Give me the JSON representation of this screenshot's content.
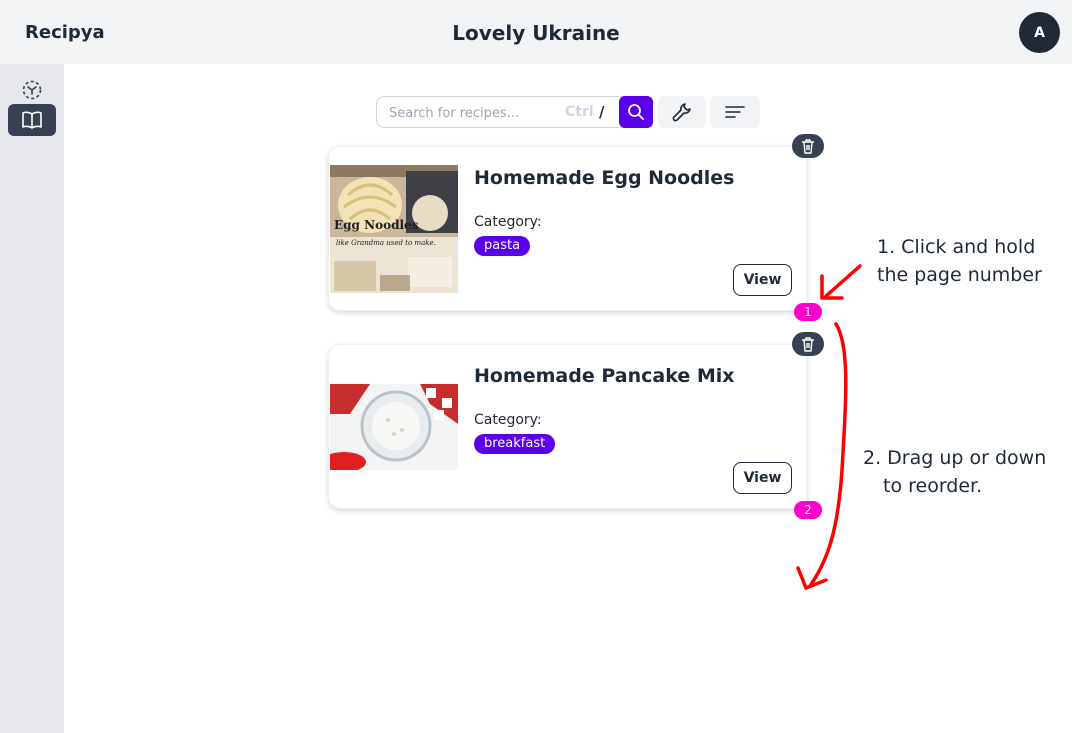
{
  "app": {
    "brand": "Recipya",
    "cookbook_title": "Lovely Ukraine",
    "avatar_initial": "A"
  },
  "sidebar": {
    "items": [
      {
        "icon": "scan-icon",
        "active": false
      },
      {
        "icon": "book-open-icon",
        "active": true
      }
    ]
  },
  "search": {
    "placeholder": "Search for recipes...",
    "value": "",
    "shortcut_key": "Ctrl",
    "shortcut_char": "/"
  },
  "toolbar": {
    "search_icon": "search-icon",
    "settings_icon": "wrench-icon",
    "sort_icon": "sort-lines-icon"
  },
  "recipes": [
    {
      "title": "Homemade Egg Noodles",
      "category_label": "Category:",
      "category": "pasta",
      "view_label": "View",
      "page_number": "1",
      "image_text_1": "Egg Noodles",
      "image_text_2": "like Grandma used to make."
    },
    {
      "title": "Homemade Pancake Mix",
      "category_label": "Category:",
      "category": "breakfast",
      "view_label": "View",
      "page_number": "2"
    }
  ],
  "annotations": {
    "step1_line1": "1. Click and hold",
    "step1_line2": "the page number",
    "step2_line1": "2. Drag up or down",
    "step2_line2": "to reorder."
  },
  "colors": {
    "accent": "#5b00ea",
    "page_badge": "#ff00cc",
    "dark": "#1f2937",
    "annotation_arrow": "#ff0000"
  }
}
